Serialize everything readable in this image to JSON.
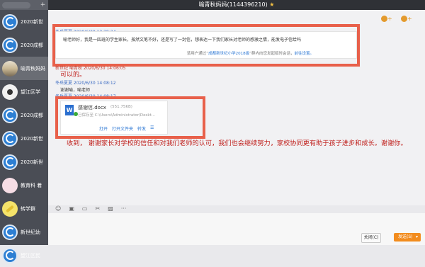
{
  "window": {
    "title": "喻青秋妈妈(1144396210)"
  },
  "sidebar": {
    "items": [
      {
        "name": "2020新世"
      },
      {
        "name": "2020成都"
      },
      {
        "name": "喻青秋妈妈"
      },
      {
        "name": "望江区学"
      },
      {
        "name": "2020成都"
      },
      {
        "name": "2020新世"
      },
      {
        "name": "2020新世"
      },
      {
        "name": "教育科 着"
      },
      {
        "name": "转学群"
      },
      {
        "name": "新世纪幼"
      },
      {
        "name": "望江区民"
      }
    ]
  },
  "messages": {
    "m1": {
      "sender_time": "冬岳夏夏 2020/6/30 13:29:24",
      "text": "喻老师好，我是一四班的学生家长，虽然文笔不好，还是写了一封信，想表达一下我们家长对老师的感激之情，能发电子信给吗",
      "footer_prefix": "该用户通过“",
      "footer_group": "成都新世纪小学2018级",
      "footer_suffix": "”群内向您发起临时会话，",
      "footer_link": "前往设置。"
    },
    "m2": {
      "sender_time": "新世纪 喻青秋 2020/6/30 14:06:05",
      "text": "可以的。"
    },
    "m3": {
      "sender_time": "冬岳夏夏 2020/6/30 14:08:12",
      "text": "谢谢喻，喻老师"
    },
    "m4": {
      "sender_time": "冬岳夏夏 2020/6/30 14:08:17",
      "file_name": "感谢信.docx",
      "file_size": "(551.75KB)",
      "file_path": "已保存至 C:\\Users\\Administrator\\Deskt...",
      "actions": [
        "打开",
        "打开文件夹",
        "转发"
      ]
    },
    "reply": "收到， 谢谢家长对学校的信任和对我们老师的认可，我们也会继续努力，家校协同更有助于孩子进步和成长。谢谢你。"
  },
  "input": {
    "close_label": "关闭(C)",
    "send_label": "发送(S)"
  },
  "icons": [
    "emoji-icon",
    "image-icon",
    "screenshot-icon",
    "cut-icon",
    "more-icon",
    "member-icon",
    "add-member-icon"
  ],
  "colors": {
    "accent": "#f28c1e",
    "highlight_box": "#e8604a",
    "reply_text": "#c0201c"
  }
}
